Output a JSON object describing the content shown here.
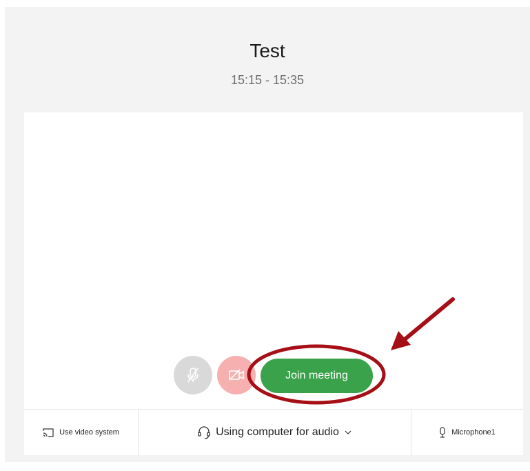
{
  "meeting": {
    "title": "Test",
    "time": "15:15 - 15:35"
  },
  "controls": {
    "mute_icon": "microphone-muted-icon",
    "video_icon": "video-off-icon",
    "join_label": "Join meeting"
  },
  "bottom_bar": {
    "video_system_label": "Use video system",
    "video_system_icon": "cast-icon",
    "audio_label": "Using computer for audio",
    "audio_icon": "headset-icon",
    "audio_dropdown_icon": "chevron-down-icon",
    "microphone_label": "Microphone1",
    "microphone_icon": "microphone-icon"
  },
  "colors": {
    "join_button": "#3aa24a",
    "video_off_button": "#f7b0b0",
    "mute_button": "#d9d9d9",
    "annotation": "#a50f15",
    "background": "#f3f3f3"
  }
}
